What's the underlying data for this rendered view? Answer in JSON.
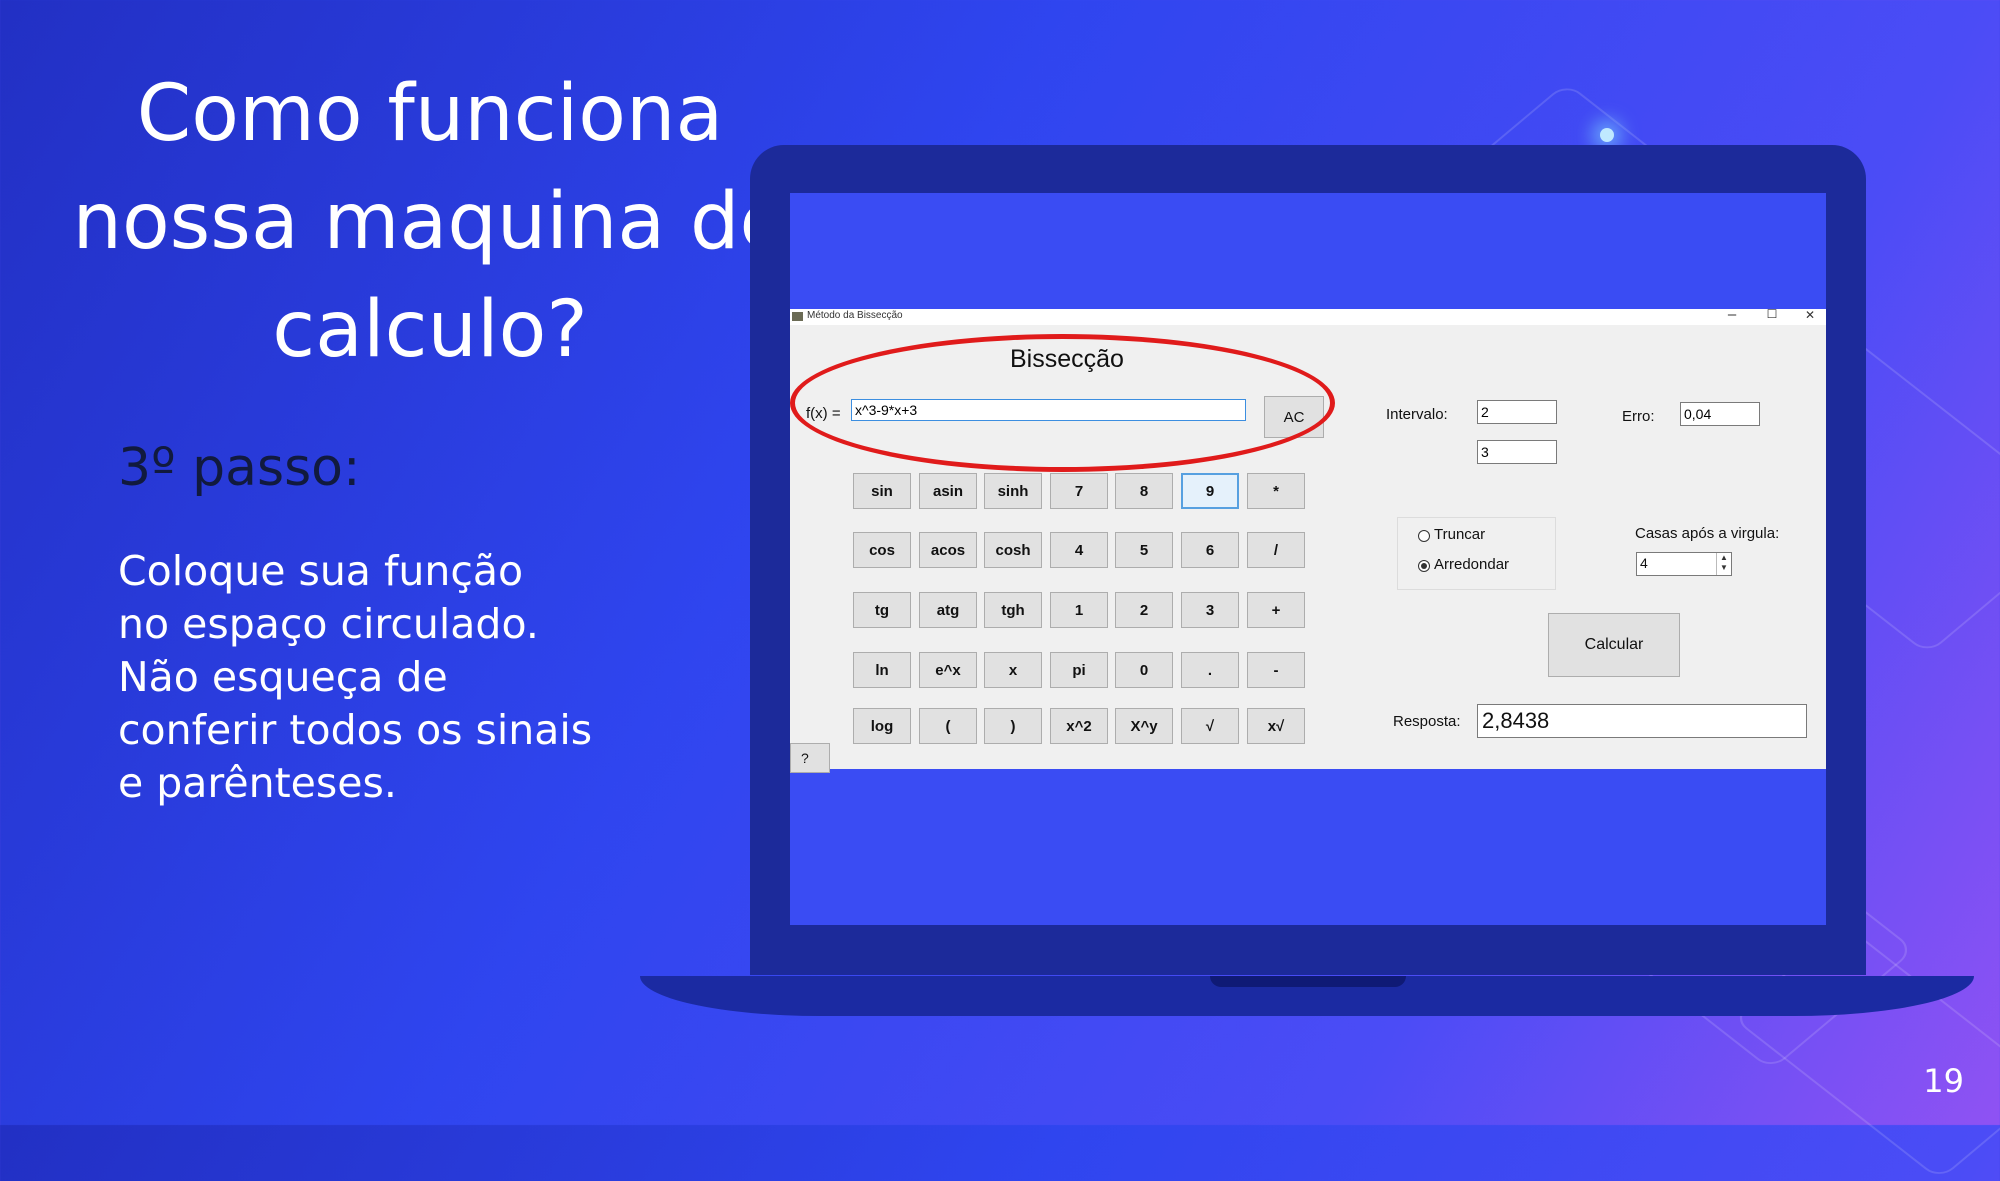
{
  "slide": {
    "title": "Como funciona nossa maquina de calculo?",
    "title_lines": [
      "Como funciona",
      "nossa maquina de",
      "calculo?"
    ],
    "step_label": "3º passo:",
    "instruction_lines": [
      "Coloque  sua função",
      "no espaço circulado.",
      "Não esqueça de",
      "conferir todos os sinais",
      "e parênteses."
    ],
    "page_number": "19",
    "colors": {
      "accent_circle": "#e01b1b",
      "background_start": "#2230c4",
      "background_end": "#8f52f3"
    }
  },
  "window": {
    "title": "Método da Bissecção",
    "controls": {
      "minimize": "–",
      "maximize": "☐",
      "close": "✕"
    },
    "heading": "Bissecção",
    "fx_label": "f(x) =",
    "fx_value": "x^3-9*x+3",
    "ac_label": "AC",
    "keypad": [
      [
        "sin",
        "asin",
        "sinh",
        "7",
        "8",
        "9",
        "*"
      ],
      [
        "cos",
        "acos",
        "cosh",
        "4",
        "5",
        "6",
        "/"
      ],
      [
        "tg",
        "atg",
        "tgh",
        "1",
        "2",
        "3",
        "+"
      ],
      [
        "ln",
        "e^x",
        "x",
        "pi",
        "0",
        ".",
        "-"
      ],
      [
        "log",
        "(",
        ")",
        "x^2",
        "X^y",
        "√",
        "x√"
      ]
    ],
    "help_label": "?",
    "intervalo_label": "Intervalo:",
    "intervalo_a": "2",
    "intervalo_b": "3",
    "erro_label": "Erro:",
    "erro_value": "0,04",
    "mode_options": [
      "Truncar",
      "Arredondar"
    ],
    "mode_selected": "Arredondar",
    "casas_label": "Casas após a virgula:",
    "casas_value": "4",
    "calcular_label": "Calcular",
    "resposta_label": "Resposta:",
    "resposta_value": "2,8438"
  }
}
